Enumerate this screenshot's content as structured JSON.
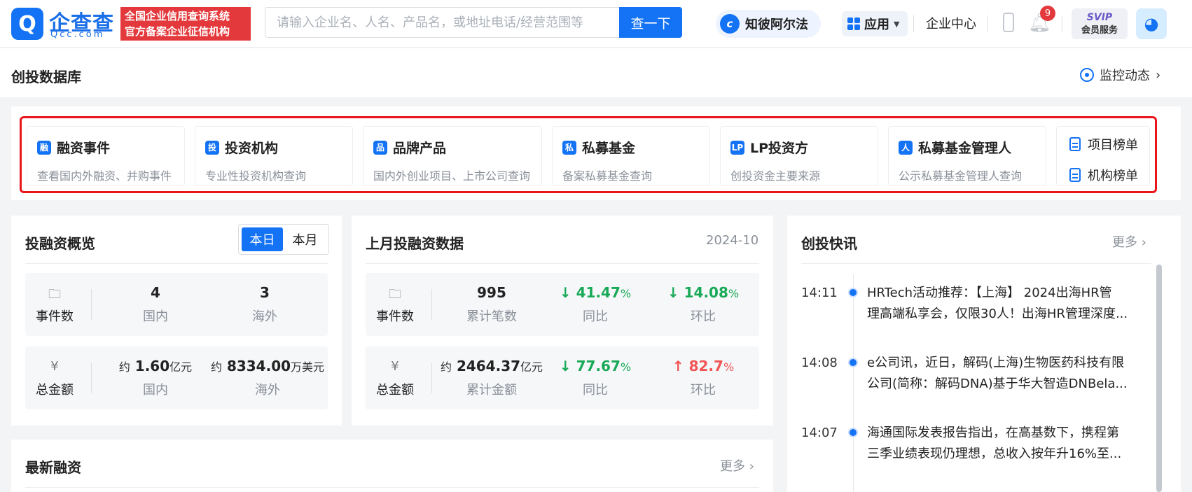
{
  "header": {
    "logo_mark": "Q",
    "logo_cn": "企查查",
    "logo_en": "Qcc.com",
    "badge_line1": "全国企业信用查询系统",
    "badge_line2": "官方备案企业征信机构",
    "search_placeholder": "请输入企业名、人名、产品名，或地址电话/经营范围等",
    "search_button": "查一下",
    "ai_label": "知彼阿尔法",
    "apps_label": "应用",
    "enterprise_center": "企业中心",
    "notification_count": "9",
    "svip_line1": "SVIP",
    "svip_line2": "会员服务"
  },
  "page": {
    "title": "创投数据库",
    "monitor_label": "监控动态"
  },
  "nav_cards": [
    {
      "title": "融资事件",
      "desc": "查看国内外融资、并购事件"
    },
    {
      "title": "投资机构",
      "desc": "专业性投资机构查询"
    },
    {
      "title": "品牌产品",
      "desc": "国内外创业项目、上市公司查询"
    },
    {
      "title": "私募基金",
      "desc": "备案私募基金查询"
    },
    {
      "title": "LP投资方",
      "desc": "创投资金主要来源"
    },
    {
      "title": "私募基金管理人",
      "desc": "公示私募基金管理人查询"
    }
  ],
  "rank_links": {
    "project": "项目榜单",
    "org": "机构榜单"
  },
  "overview": {
    "title": "投融资概览",
    "tab_day": "本日",
    "tab_month": "本月",
    "events_label": "事件数",
    "amount_label": "总金额",
    "events_domestic": "4",
    "events_overseas": "3",
    "domestic_label": "国内",
    "overseas_label": "海外",
    "approx": "约",
    "amount_domestic": "1.60",
    "amount_domestic_unit": "亿元",
    "amount_overseas": "8334.00",
    "amount_overseas_unit": "万美元"
  },
  "last_month": {
    "title": "上月投融资数据",
    "period": "2024-10",
    "events_label": "事件数",
    "amount_label": "总金额",
    "events_total": "995",
    "events_total_label": "累计笔数",
    "events_yoy": "41.47",
    "events_qoq": "14.08",
    "amount_total_prefix": "约",
    "amount_total": "2464.37",
    "amount_unit": "亿元",
    "amount_total_label": "累计金额",
    "amount_yoy": "77.67",
    "amount_qoq": "82.7",
    "pct": "%",
    "yoy_label": "同比",
    "qoq_label": "环比",
    "arrow_down": "↓",
    "arrow_up": "↑"
  },
  "latest": {
    "title": "最新融资",
    "more": "更多"
  },
  "news": {
    "title": "创投快讯",
    "more": "更多",
    "items": [
      {
        "time": "14:11",
        "line1": "HRTech活动推荐：【上海】 2024出海HR管",
        "line2": "理高端私享会，仅限30人！出海HR管理深度..."
      },
      {
        "time": "14:08",
        "line1": "e公司讯，近日，解码(上海)生物医药科技有限",
        "line2": "公司(简称：解码DNA)基于华大智造DNBela..."
      },
      {
        "time": "14:07",
        "line1": "海通国际发表报告指出，在高基数下，携程第",
        "line2": "三季业绩表现仍理想，总收入按年升16%至..."
      }
    ]
  },
  "colors": {
    "brand": "#1473f5",
    "down": "#18a957",
    "up": "#f05454",
    "highlight": "#e8161b"
  }
}
